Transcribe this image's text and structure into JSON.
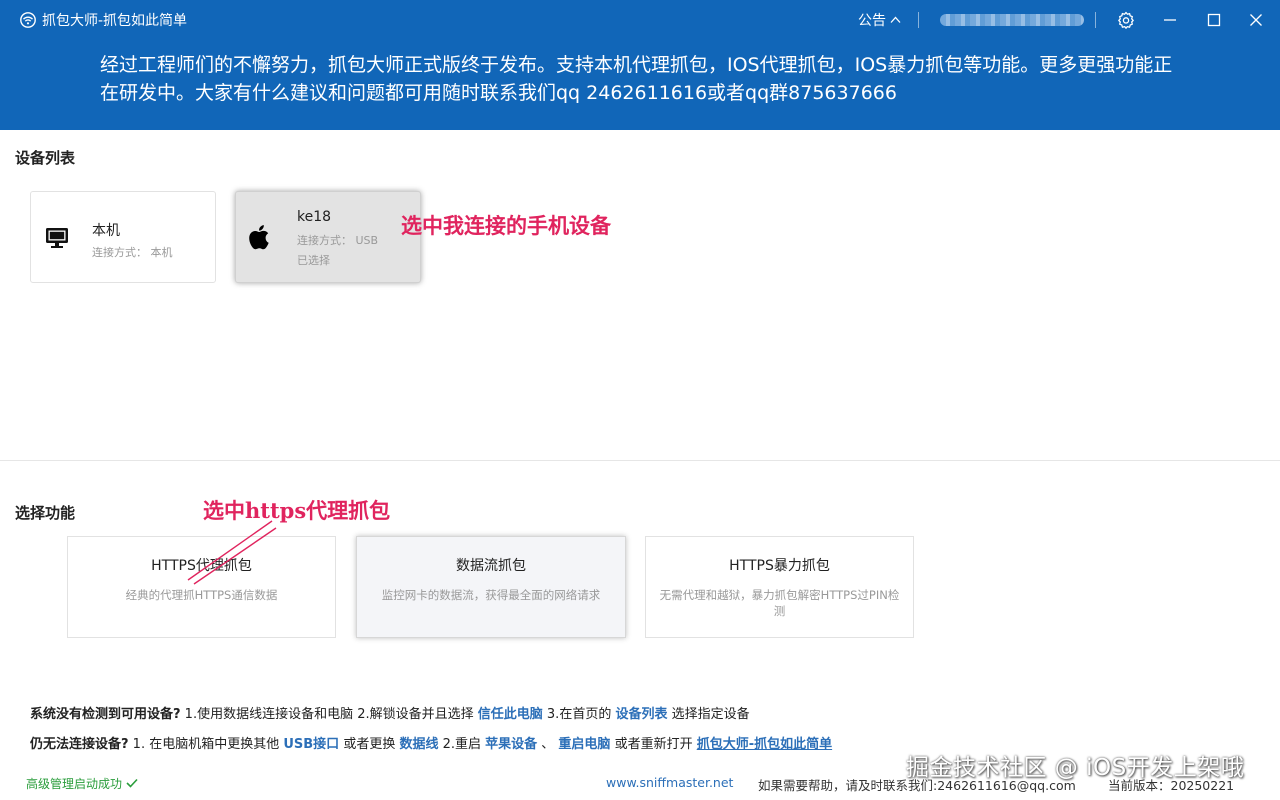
{
  "titlebar": {
    "title": "抓包大师-抓包如此简单",
    "notice_label": "公告",
    "account_masked": ""
  },
  "banner": {
    "text": "经过工程师们的不懈努力，抓包大师正式版终于发布。支持本机代理抓包，IOS代理抓包，IOS暴力抓包等功能。更多更强功能正在研发中。大家有什么建议和问题都可用随时联系我们qq 2462611616或者qq群875637666"
  },
  "devices": {
    "title": "设备列表",
    "items": [
      {
        "name": "本机",
        "connection": "连接方式： 本机",
        "status": "",
        "icon": "monitor-icon"
      },
      {
        "name": "ke18",
        "connection": "连接方式： USB",
        "status": "已选择",
        "icon": "apple-icon"
      }
    ],
    "annotation": "选中我连接的手机设备"
  },
  "functions": {
    "title": "选择功能",
    "annotation": "选中https代理抓包",
    "items": [
      {
        "title": "HTTPS代理抓包",
        "desc": "经典的代理抓HTTPS通信数据"
      },
      {
        "title": "数据流抓包",
        "desc": "监控网卡的数据流，获得最全面的网络请求"
      },
      {
        "title": "HTTPS暴力抓包",
        "desc": "无需代理和越狱，暴力抓包解密HTTPS过PIN检测"
      }
    ]
  },
  "help": {
    "line1": {
      "q": "系统没有检测到可用设备?",
      "t1": " 1.使用数据线连接设备和电脑  2.解锁设备并且选择 ",
      "l1": "信任此电脑",
      "t2": "  3.在首页的 ",
      "l2": "设备列表",
      "t3": " 选择指定设备"
    },
    "line2": {
      "q": "仍无法连接设备?",
      "t1": "  1. 在电脑机箱中更换其他 ",
      "l1": "USB接口",
      "t2": " 或者更换 ",
      "l2": "数据线",
      "t3": "   2.重启 ",
      "l3": "苹果设备",
      "t4": " 、 ",
      "l4": "重启电脑",
      "t5": " 或者重新打开 ",
      "l5": "抓包大师-抓包如此简单"
    }
  },
  "footer": {
    "status": "高级管理启动成功",
    "website": "www.sniffmaster.net",
    "help_text": "如果需要帮助，请及时联系我们:2462611616@qq.com",
    "version": "当前版本：20250221"
  },
  "watermark": "掘金技术社区 @ iOS开发上架哦",
  "colors": {
    "brand": "#1166b8",
    "annotation": "#e0245e",
    "link": "#2c6fb8",
    "success": "#2a9d3b"
  }
}
